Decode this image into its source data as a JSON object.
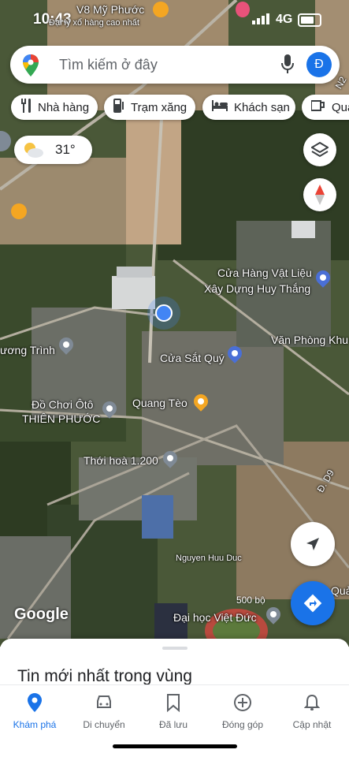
{
  "status_bar": {
    "time": "10:43",
    "network": "4G"
  },
  "top_overlay": {
    "place_top": "V8 Mỹ Phước",
    "place_top2": "Đại lý xổ hàng cao nhất"
  },
  "search": {
    "placeholder": "Tìm kiếm ở đây",
    "avatar_letter": "Đ"
  },
  "chips": [
    {
      "label": "Nhà hàng",
      "icon": "fork-knife-icon"
    },
    {
      "label": "Trạm xăng",
      "icon": "gas-station-icon"
    },
    {
      "label": "Khách sạn",
      "icon": "bed-icon"
    },
    {
      "label": "Quá",
      "icon": "coffee-icon"
    }
  ],
  "weather": {
    "temp": "31°",
    "icon": "partly-sunny-icon"
  },
  "map_labels": {
    "store": "Cửa Hàng Vật Liệu",
    "store2": "Xây Dựng Huy Thắng",
    "office": "Văn Phòng Khu",
    "truong_trinh": "ương Trình",
    "cua_sat": "Cửa Sắt Quý",
    "do_choi": "Đồ Chơi Ôtô",
    "thien_phuoc": "THIÊN PHƯỚC",
    "quang_teo": "Quang Tèo",
    "thoi_hoa": "Thới hoà 1.200",
    "d9": "Đ. D9",
    "nguyen_huu_duc": "Nguyen Huu Duc",
    "dai_hoc": "Đại học Việt Đức",
    "n2": "N2",
    "qua": "Quả",
    "scale": "500 bộ"
  },
  "branding": {
    "google": "Google"
  },
  "sheet": {
    "title": "Tin mới nhất trong vùng"
  },
  "nav": [
    {
      "label": "Khám phá",
      "icon": "location-pin-icon",
      "active": true
    },
    {
      "label": "Di chuyển",
      "icon": "car-icon"
    },
    {
      "label": "Đã lưu",
      "icon": "bookmark-icon"
    },
    {
      "label": "Đóng góp",
      "icon": "plus-circle-icon"
    },
    {
      "label": "Cập nhật",
      "icon": "bell-icon"
    }
  ],
  "colors": {
    "accent": "#1a73e8",
    "map_base": "#4b5a3c",
    "pin_blue": "#4a6fd6",
    "pin_yellow": "#f4a622",
    "pin_gray": "#7f8a96"
  }
}
